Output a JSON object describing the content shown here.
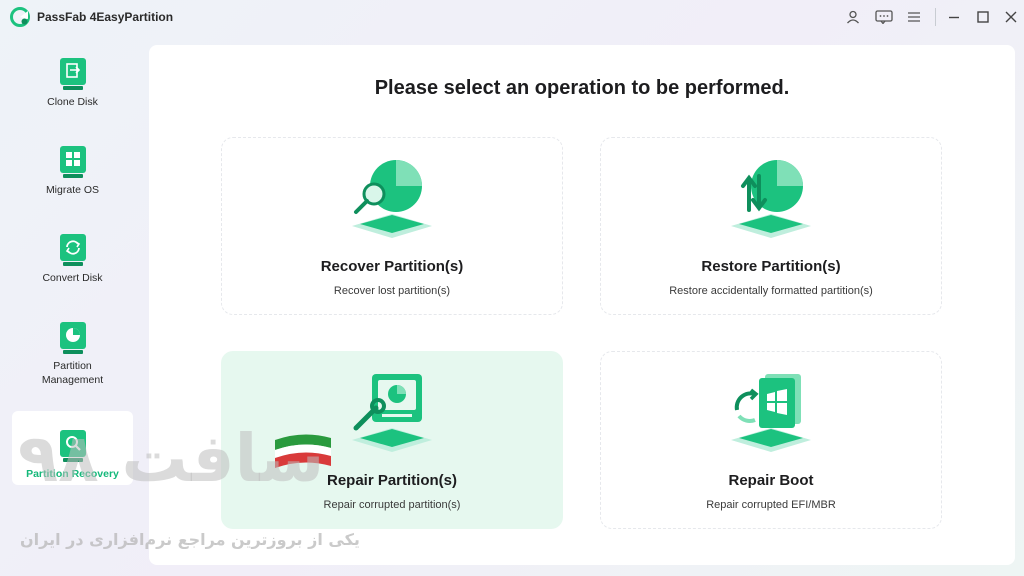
{
  "app": {
    "title": "PassFab 4EasyPartition",
    "accent": "#1cc27f"
  },
  "titlebar_icons": [
    "account-icon",
    "feedback-icon",
    "menu-icon",
    "minimize-icon",
    "maximize-icon",
    "close-icon"
  ],
  "sidebar": {
    "items": [
      {
        "label": "Clone Disk",
        "icon": "clone-disk-icon"
      },
      {
        "label": "Migrate OS",
        "icon": "migrate-os-icon"
      },
      {
        "label": "Convert Disk",
        "icon": "convert-disk-icon"
      },
      {
        "label": "Partition Management",
        "icon": "partition-management-icon"
      },
      {
        "label": "Partition Recovery",
        "icon": "partition-recovery-icon",
        "active": true
      }
    ]
  },
  "main": {
    "title": "Please select an operation to be performed.",
    "cards": [
      {
        "title": "Recover Partition(s)",
        "desc": "Recover lost partition(s)",
        "icon": "recover-partition-icon"
      },
      {
        "title": "Restore Partition(s)",
        "desc": "Restore accidentally formatted partition(s)",
        "icon": "restore-partition-icon"
      },
      {
        "title": "Repair Partition(s)",
        "desc": "Repair corrupted partition(s)",
        "icon": "repair-partition-icon"
      },
      {
        "title": "Repair Boot",
        "desc": "Repair corrupted EFI/MBR",
        "icon": "repair-boot-icon"
      }
    ]
  },
  "watermark": {
    "big": "سافت ۹۸",
    "small": "یکی از بروزترین مراجع نرم‌افزاری در ایران"
  }
}
